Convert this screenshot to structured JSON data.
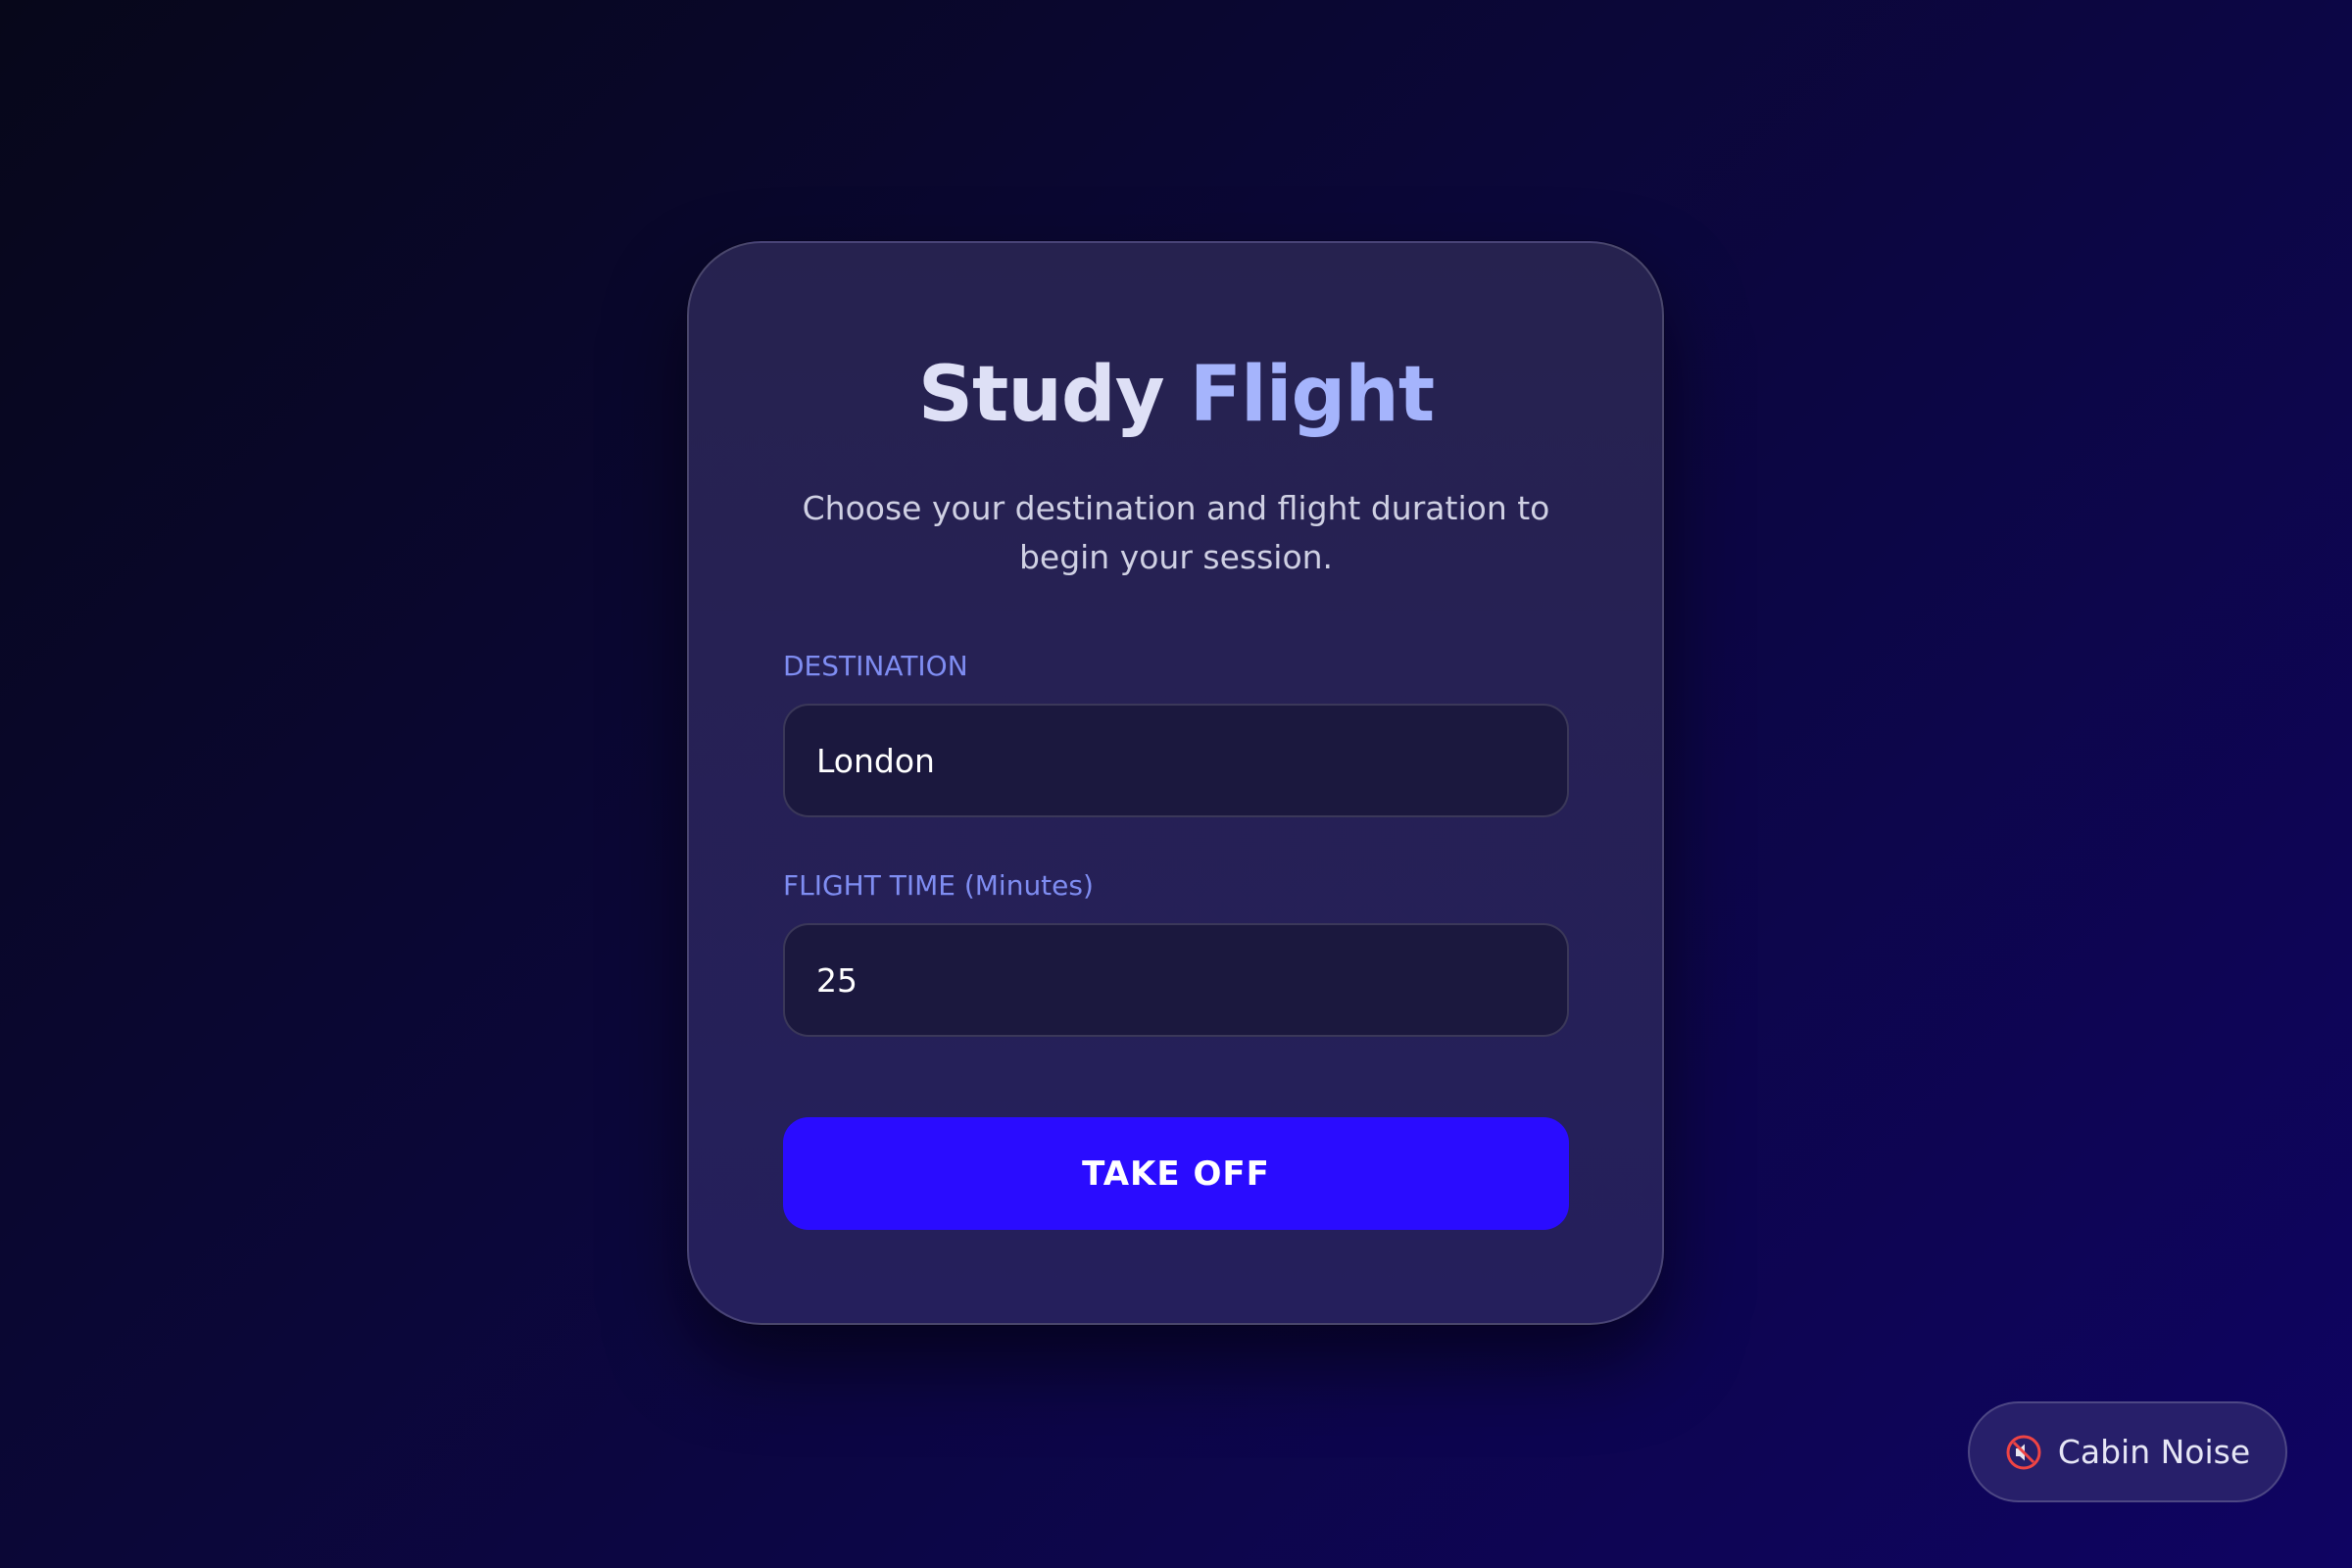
{
  "card": {
    "title_part1": "Study",
    "title_part2": "Flight",
    "subtitle": "Choose your destination and flight duration to begin your session."
  },
  "form": {
    "destination": {
      "label": "DESTINATION",
      "value": "London"
    },
    "flight_time": {
      "label": "FLIGHT TIME (Minutes)",
      "value": "25"
    },
    "submit_label": "TAKE OFF"
  },
  "cabin_noise": {
    "label": "Cabin Noise",
    "icon": "muted-speaker-icon"
  },
  "colors": {
    "accent": "#2a0cff",
    "label": "#7f8df2",
    "title_highlight": "#a5b4fc",
    "card_bg": "#26224f",
    "field_bg": "#1b183e"
  }
}
